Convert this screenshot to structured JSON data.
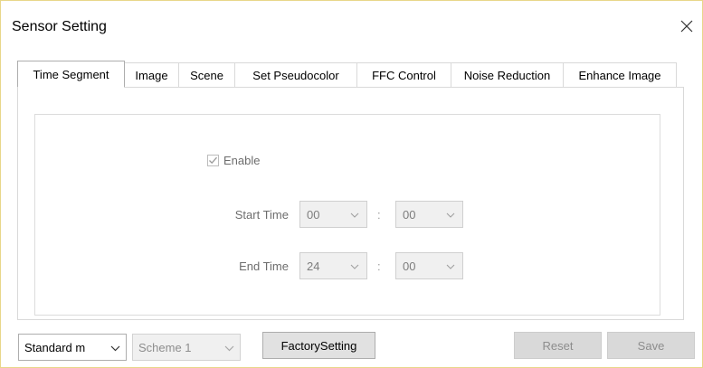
{
  "window": {
    "title": "Sensor Setting"
  },
  "tabs": [
    {
      "label": "Time Segment",
      "active": true
    },
    {
      "label": "Image",
      "active": false
    },
    {
      "label": "Scene",
      "active": false
    },
    {
      "label": "Set Pseudocolor",
      "active": false
    },
    {
      "label": "FFC Control",
      "active": false
    },
    {
      "label": "Noise Reduction",
      "active": false
    },
    {
      "label": "Enhance Image",
      "active": false
    }
  ],
  "time_segment": {
    "enable_label": "Enable",
    "enable_checked": true,
    "start_time_label": "Start Time",
    "start_hour": "00",
    "start_minute": "00",
    "end_time_label": "End Time",
    "end_hour": "24",
    "end_minute": "00",
    "separator": ":"
  },
  "bottom": {
    "mode_value": "Standard m",
    "scheme_value": "Scheme 1",
    "factory_label": "FactorySetting",
    "reset_label": "Reset",
    "save_label": "Save"
  },
  "icons": {
    "close": "close-icon",
    "chevron": "chevron-down-icon",
    "check": "checkmark-icon"
  }
}
